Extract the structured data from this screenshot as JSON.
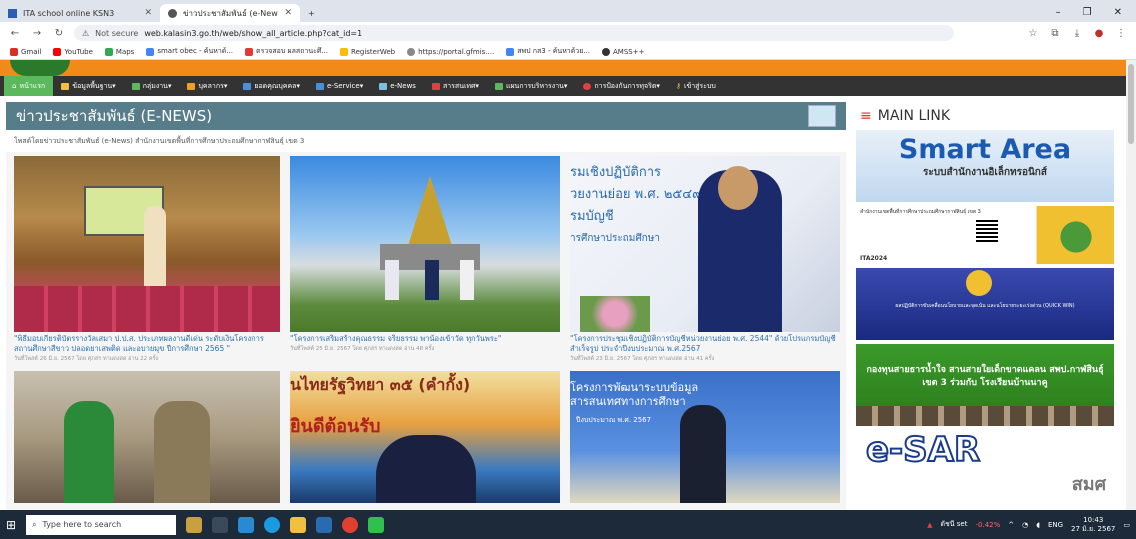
{
  "browser": {
    "tabs": [
      {
        "label": "ITA school online KSN3",
        "active": false
      },
      {
        "label": "ข่าวประชาสัมพันธ์ (e-News) - สำนั",
        "active": true
      }
    ],
    "new_tab": "+",
    "url_warning": "Not secure",
    "url": "web.kalasin3.go.th/web/show_all_article.php?cat_id=1",
    "bookmarks": [
      "Gmail",
      "YouTube",
      "Maps",
      "smart obec - ค้นหาด้...",
      "ตรวจสอบ ผลสถานะศึ...",
      "RegisterWeb",
      "https://portal.gfmis....",
      "สพป กส3 - ค้นหาด้วย...",
      "AMSS++"
    ]
  },
  "site": {
    "menu": [
      "หน้าแรก",
      "ข้อมูลพื้นฐาน▾",
      "กลุ่มงาน▾",
      "บุคลากร▾",
      "ยอดคุณบุคคล▾",
      "e-Service▾",
      "e-News",
      "สารสนเทศ▾",
      "แผนการบริหารงาน▾",
      "การป้องกันการทุจริต▾",
      "เข้าสู่ระบบ"
    ],
    "news_title": "ข่าวประชาสัมพันธ์ (E-NEWS)",
    "posted_by": "โพสต์โดยข่าวประชาสัมพันธ์ (e-News) สำนักงานเขตพื้นที่การศึกษาประถมศึกษากาฬสินธุ์ เขต 3",
    "articles": [
      {
        "title": "\"พิธีมอบเกียรติบัตรรางวัลเสมา ป.ป.ส. ประเภทผลงานดีเด่น ระดับเงินโครงการสถานศึกษาสีขาว ปลอดยาเสพติด และอบายมุข ปีการศึกษา 2565 \"",
        "meta": "วันที่โพสต์ 26 มิ.ย. 2567 โดย ศุภสร ทาแดงสด อ่าน 22 ครั้ง"
      },
      {
        "title": "\"โครงการเสริมสร้างคุณธรรม จริยธรรม พาน้องเข้าวัด ทุกวันพระ\"",
        "meta": "วันที่โพสต์ 25 มิ.ย. 2567 โดย ศุภสร ทาแดงสด อ่าน 48 ครั้ง"
      },
      {
        "title": "\"โครงการประชุมเชิงปฏิบัติการบัญชีหน่วยงานย่อย พ.ศ. 2544\" ด้วยโปรแกรมบัญชีสำเร็จรูป ประจำปีงบประมาณ พ.ศ.2567",
        "meta": "วันที่โพสต์ 23 มิ.ย. 2567 โดย ศุภสร ทาแดงสด อ่าน 41 ครั้ง"
      }
    ],
    "img_texts": {
      "a3_lines": [
        "รมเชิงปฏิบัติการ",
        "วยงานย่อย พ.ศ. ๒๕๔๙",
        "รมบัญชี",
        "ารศึกษาประถมศึกษา"
      ],
      "a5_top": "นไทยรัฐวิทยา ๓๕ (คำกั้ง)",
      "a5_mid": "ยินดีต้อนรับ",
      "a6_top": "โครงการพัฒนาระบบข้อมูล สารสนเทศทางการศึกษา",
      "a6_sub": "ปีงบประมาณ พ.ศ. 2567"
    },
    "sidebar": {
      "title": "MAIN LINK",
      "smart_area": "Smart Area",
      "smart_area_sub": "ระบบสำนักงานอิเล็กทรอนิกส์",
      "ita_label": "ITA2024",
      "ita_top": "สำนักงานเขตพื้นที่การศึกษาประถมศึกษากาฬสินธุ์ เขต 3",
      "quickwin_text": "ผลปฏิบัติการขับเคลื่อนนโยบายและจุดเน้น และนโยบายระยะเร่งด่วน (QUICK WIN)",
      "fund_text": "กองทุนสายธารน้ำใจ สานสายใยเด็กขาดแคลน สพป.กาฬสินธุ์ เขต 3 ร่วมกับ โรงเรียนบ้านนาคู",
      "esar": "e-SAR",
      "esar_sub": "สมศ"
    }
  },
  "taskbar": {
    "search_placeholder": "Type here to search",
    "stock": "ดัชนี set",
    "stock_change": "-0.42%",
    "lang": "ENG",
    "time": "10:43",
    "date": "27 มิ.ย. 2567"
  },
  "colors": {
    "menu_bg": "#333333",
    "orange": "#f28a19",
    "news_head": "#577c8a",
    "link": "#2a6fb0"
  }
}
